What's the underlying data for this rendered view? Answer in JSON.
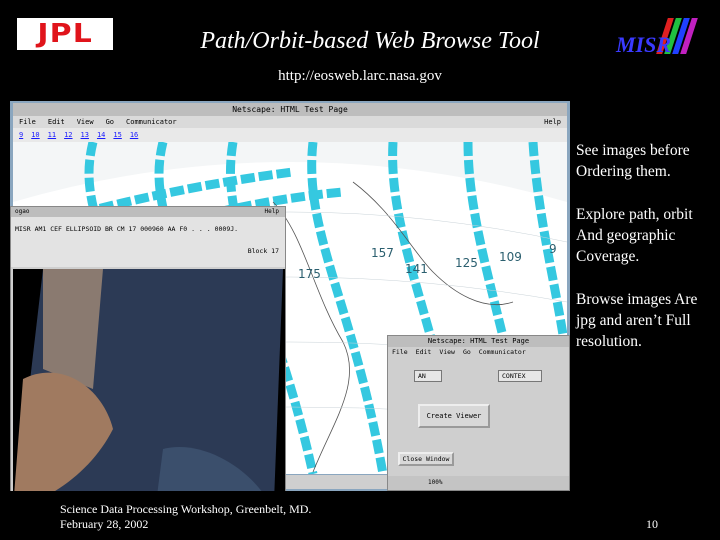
{
  "header": {
    "jpl_logo": "JPL",
    "title": "Path/Orbit-based Web Browse Tool",
    "misr_logo": "MISR",
    "url": "http://eosweb.larc.nasa.gov"
  },
  "screenshot": {
    "main_window_title": "Netscape: HTML Test Page",
    "menu": [
      "File",
      "Edit",
      "View",
      "Go",
      "Communicator"
    ],
    "help": "Help",
    "path_links": [
      "9",
      "10",
      "11",
      "12",
      "13",
      "14",
      "15",
      "16"
    ],
    "orbit_labels": [
      "175",
      "157",
      "141",
      "125",
      "109",
      "9"
    ],
    "browse_window": {
      "menu_left": "ogao",
      "help": "Help",
      "info_line": "MISR AM1 CEF ELLIPSOID BR CM 17 000960 AA F0 . . . 0009J.",
      "block": "Block 17"
    },
    "viewer_window": {
      "title": "Netscape: HTML Test Page",
      "menu": [
        "File",
        "Edit",
        "View",
        "Go",
        "Communicator"
      ],
      "select_left": "AN",
      "select_right": "CONTEX",
      "create_viewer": "Create Viewer",
      "close_window": "Close Window",
      "status_percent": "100%"
    }
  },
  "bullets": [
    "See images before Ordering them.",
    "Explore path, orbit And geographic Coverage.",
    "Browse images Are jpg and aren’t Full resolution."
  ],
  "footer": {
    "line1": "Science Data Processing Workshop, Greenbelt, MD.",
    "line2": "February 28, 2002",
    "page": "10"
  },
  "colors": {
    "background": "#000000",
    "orbit_stripe": "#35c8e0",
    "jpl_red": "#e0141b",
    "misr_blue": "#3a3aff"
  }
}
